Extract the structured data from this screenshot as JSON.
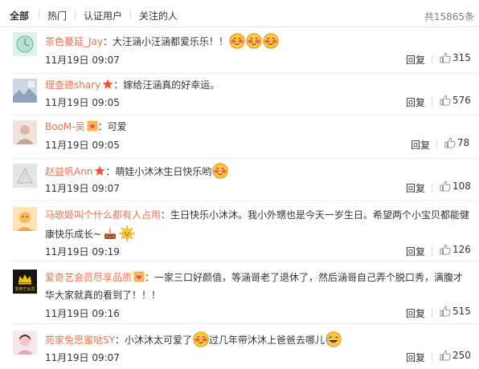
{
  "tabs": {
    "all": "全部",
    "hot": "热门",
    "verified": "认证用户",
    "following": "关注的人"
  },
  "total_label": "共15865条",
  "comments": [
    {
      "user": "茶色蔓延_Jay",
      "text": "：大汪涵小汪涵都爱乐乐！！",
      "date": "11月19日 09:07",
      "reply": "回复",
      "likes": "315"
    },
    {
      "user": "理查德shary",
      "text": "：嫁给汪涵真的好幸运。",
      "date": "11月19日 09:05",
      "reply": "回复",
      "likes": "576"
    },
    {
      "user": "BooM-吴",
      "text": "：可爱",
      "date": "11月19日 09:05",
      "reply": "回复",
      "likes": "78"
    },
    {
      "user": "赵益帆Ann",
      "text": "：萌娃小沐沐生日快乐哟",
      "date": "11月19日 09:07",
      "reply": "回复",
      "likes": "108"
    },
    {
      "user": "马歌姬叫个什么都有人占用",
      "text": "：生日快乐小沐沐。我小外甥也是今天一岁生日。希望两个小宝贝都能健",
      "text2": "康快乐成长~",
      "date": "11月19日 09:19",
      "reply": "回复",
      "likes": "126"
    },
    {
      "user": "爱奇艺会员尽享品质",
      "text": "：一家三口好颜值，等涵哥老了退休了，然后涵哥自己弄个脱口秀，满腹才",
      "text2": "华大家就真的看到了！！！",
      "avatar_text": "爱奇艺会员",
      "date": "11月19日 09:16",
      "reply": "回复",
      "likes": "515"
    },
    {
      "user": "苑家兔思蜜哒SY",
      "text": "：小沐沐太可爱了",
      "text_b": "过几年带沐沐上爸爸去哪儿",
      "date": "11月19日 09:07",
      "reply": "回复",
      "likes": "250"
    }
  ]
}
